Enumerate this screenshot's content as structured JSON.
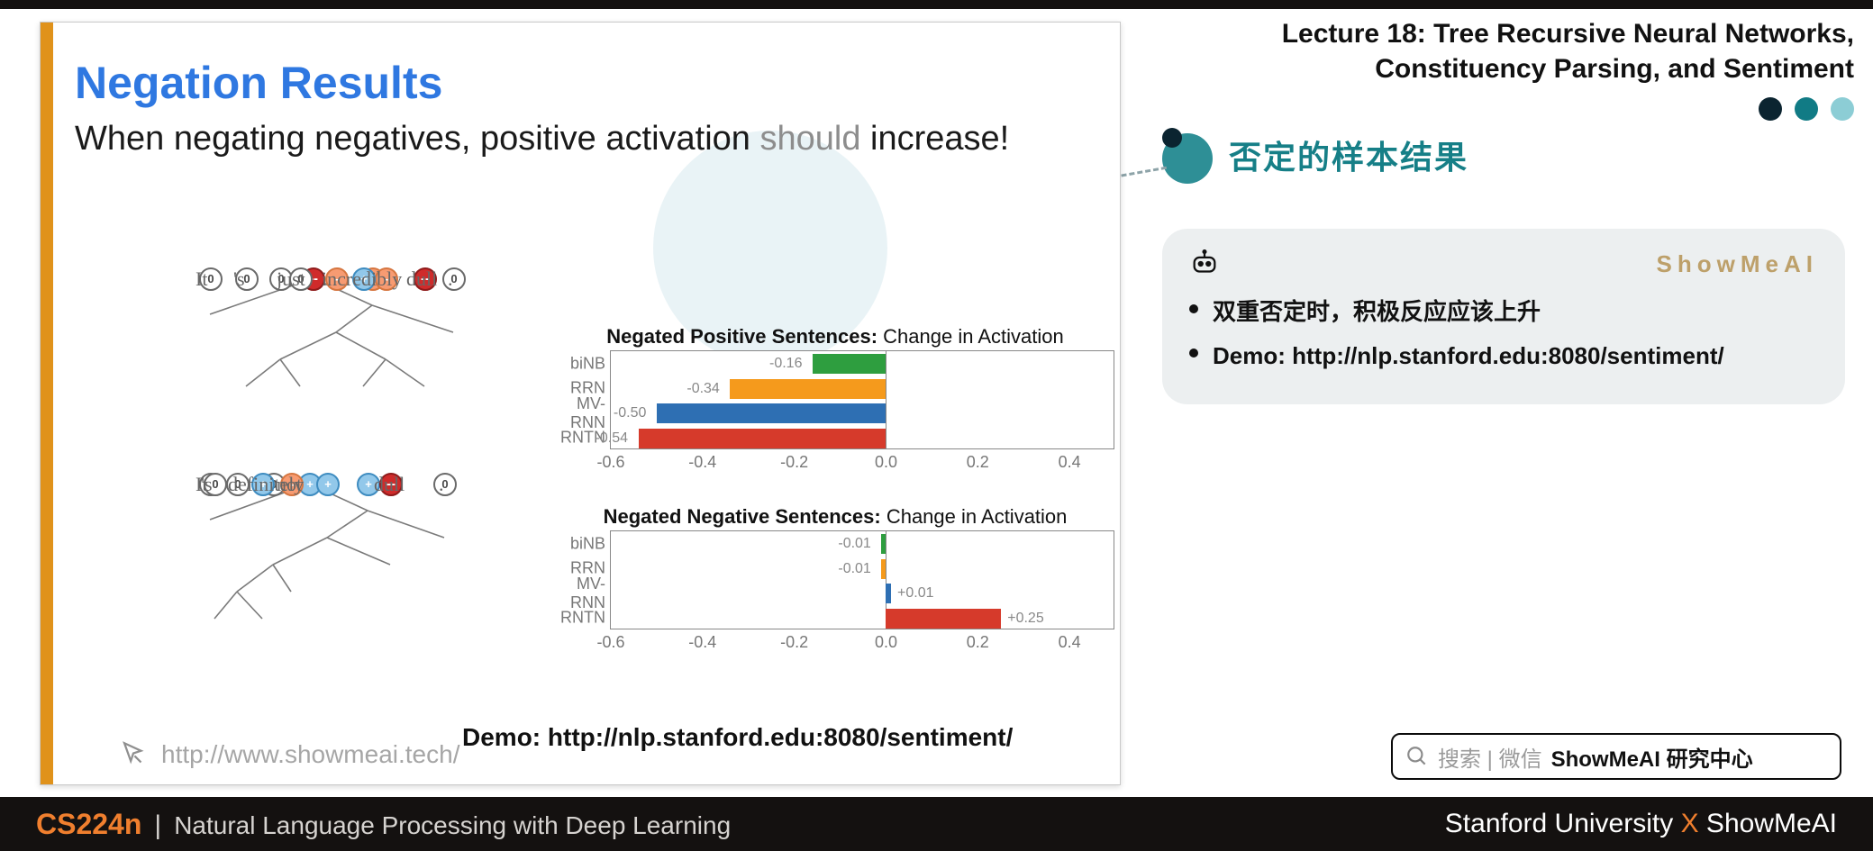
{
  "header": {
    "lecture_line": "Lecture 18: Tree Recursive Neural Networks, Constituency Parsing, and Sentiment",
    "subhead": "否定的样本结果"
  },
  "slide": {
    "title": "Negation Results",
    "body_pre": "When negating negatives, positive activation ",
    "body_grey": "should",
    "body_post": " increase!",
    "demo_line": "Demo: http://nlp.stanford.edu:8080/sentiment/",
    "footer_url": "http://www.showmeai.tech/"
  },
  "tree1_words": {
    "w0": "It",
    "w1": "'s",
    "w2": "just",
    "w3": "incredibly",
    "w4": "dull",
    "w5": "."
  },
  "tree2_words": {
    "w0": "It",
    "w1": "'s",
    "w2": "definitely",
    "w3": "not",
    "w4": "dull",
    "w5": "."
  },
  "note": {
    "brand": "ShowMeAI",
    "items": [
      "双重否定时，积极反应应该上升",
      "Demo: http://nlp.stanford.edu:8080/sentiment/"
    ]
  },
  "search_chip": {
    "grey": "搜索 | 微信 ",
    "bold": "ShowMeAI 研究中心"
  },
  "footer": {
    "course_code": "CS224n",
    "course_title": "Natural Language Processing with Deep Learning",
    "right_pre": "Stanford University ",
    "right_x": "X",
    "right_post": " ShowMeAI"
  },
  "chart_data": [
    {
      "type": "bar",
      "title_bold": "Negated Positive Sentences:",
      "title_rest": " Change in Activation",
      "categories": [
        "biNB",
        "RRN",
        "MV-RNN",
        "RNTN"
      ],
      "values": [
        -0.16,
        -0.34,
        -0.5,
        -0.54
      ],
      "colors": [
        "#2e9e3f",
        "#f59a1c",
        "#2e6fb3",
        "#d63a2b"
      ],
      "xlim": [
        -0.6,
        0.5
      ],
      "ticks": [
        -0.6,
        -0.4,
        -0.2,
        0.0,
        0.2,
        0.4
      ]
    },
    {
      "type": "bar",
      "title_bold": "Negated Negative Sentences:",
      "title_rest": " Change in Activation",
      "categories": [
        "biNB",
        "RRN",
        "MV-RNN",
        "RNTN"
      ],
      "values": [
        -0.01,
        -0.01,
        0.01,
        0.25
      ],
      "colors": [
        "#2e9e3f",
        "#f59a1c",
        "#2e6fb3",
        "#d63a2b"
      ],
      "xlim": [
        -0.6,
        0.5
      ],
      "ticks": [
        -0.6,
        -0.4,
        -0.2,
        0.0,
        0.2,
        0.4
      ]
    }
  ]
}
